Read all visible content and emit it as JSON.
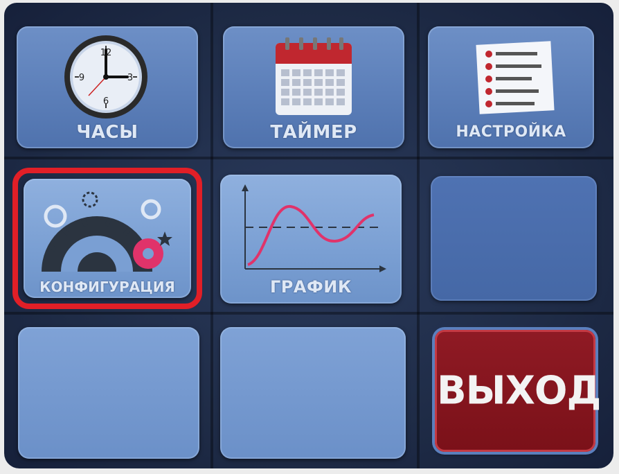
{
  "menu": {
    "tiles": [
      {
        "id": "clock",
        "label": "ЧАСЫ",
        "icon": "clock-icon",
        "clock_numbers": [
          "12",
          "3",
          "6",
          "9"
        ]
      },
      {
        "id": "timer",
        "label": "ТАЙМЕР",
        "icon": "calendar-icon"
      },
      {
        "id": "settings",
        "label": "НАСТРОЙКА",
        "icon": "checklist-icon"
      },
      {
        "id": "config",
        "label": "КОНФИГУРАЦИЯ",
        "icon": "gears-icon",
        "selected": true
      },
      {
        "id": "graph",
        "label": "ГРАФИК",
        "icon": "graph-icon"
      },
      {
        "id": "empty-1",
        "label": ""
      },
      {
        "id": "empty-2",
        "label": ""
      },
      {
        "id": "empty-3",
        "label": ""
      }
    ],
    "exit_label": "ВЫХОД"
  },
  "colors": {
    "selection": "#e11f27",
    "exit_bg": "#8f1a24",
    "tile_bg": "#6d8fc6",
    "accent_pink": "#e0336a"
  }
}
